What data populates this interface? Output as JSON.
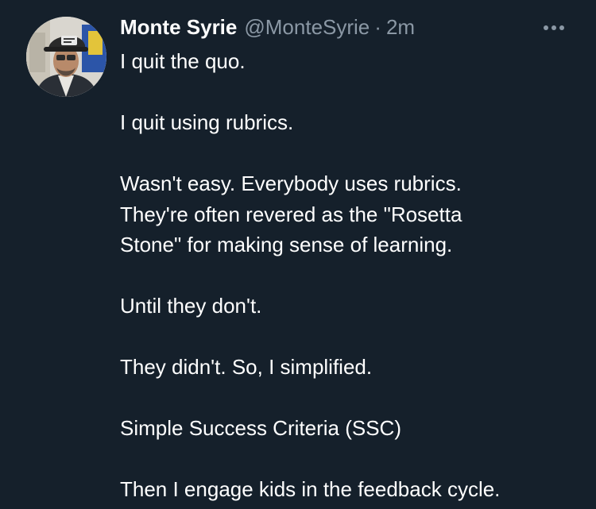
{
  "tweet": {
    "author": {
      "display_name": "Monte Syrie",
      "handle": "@MonteSyrie",
      "avatar": "avatar-photo"
    },
    "separator": "·",
    "time": "2m",
    "more_icon": "more-horizontal-icon",
    "paragraphs": [
      [
        "I quit the quo."
      ],
      [
        "I quit using rubrics."
      ],
      [
        "Wasn't easy. Everybody uses rubrics.",
        "They're often revered as the \"Rosetta",
        "Stone\" for making sense of learning."
      ],
      [
        "Until they don't."
      ],
      [
        "They didn't. So, I simplified."
      ],
      [
        "Simple Success Criteria (SSC)"
      ],
      [
        "Then I engage kids in the feedback cycle."
      ]
    ]
  },
  "colors": {
    "background": "#15202b",
    "text_primary": "#ffffff",
    "text_secondary": "#8b98a5"
  }
}
